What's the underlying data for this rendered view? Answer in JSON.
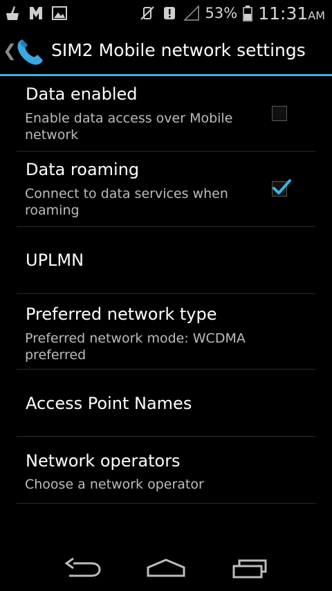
{
  "status_bar": {
    "battery_percent": "53%",
    "time": "11:31",
    "ampm": "AM",
    "icons": [
      "cleaner-icon",
      "app-notification-icon",
      "image-icon",
      "mute-icon",
      "alert-icon",
      "signal-icon",
      "battery-icon"
    ]
  },
  "action_bar": {
    "title": "SIM2 Mobile network settings",
    "accent_color": "#33b5e5"
  },
  "settings": {
    "data_enabled": {
      "title": "Data enabled",
      "summary": "Enable data access over Mobile network",
      "checked": false
    },
    "data_roaming": {
      "title": "Data roaming",
      "summary": "Connect to data services when roaming",
      "checked": true
    },
    "uplmn": {
      "title": "UPLMN"
    },
    "preferred_network_type": {
      "title": "Preferred network type",
      "summary": "Preferred network mode: WCDMA preferred"
    },
    "access_point_names": {
      "title": "Access Point Names"
    },
    "network_operators": {
      "title": "Network operators",
      "summary": "Choose a network operator"
    }
  },
  "nav_bar": {
    "buttons": [
      "back-icon",
      "home-icon",
      "recent-apps-icon"
    ]
  }
}
